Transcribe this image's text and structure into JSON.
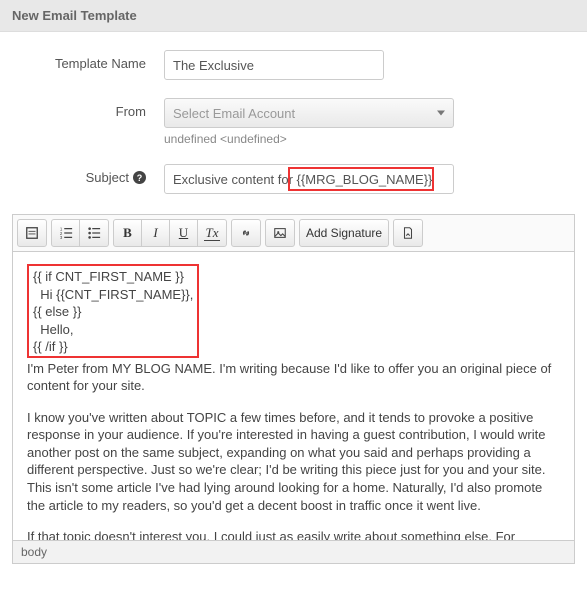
{
  "header": {
    "title": "New Email Template"
  },
  "form": {
    "templateName": {
      "label": "Template Name",
      "value": "The Exclusive"
    },
    "from": {
      "label": "From",
      "placeholder": "Select Email Account",
      "helper": "undefined <undefined>"
    },
    "subject": {
      "label": "Subject",
      "value": "Exclusive content for {{MRG_BLOG_NAME}}"
    }
  },
  "toolbar": {
    "bold": "B",
    "italic": "I",
    "underline": "U",
    "removeFormat": "Tx",
    "addSignature": "Add Signature"
  },
  "editor": {
    "cond_l1": "{{ if CNT_FIRST_NAME }}",
    "cond_l2": "  Hi {{CNT_FIRST_NAME}},",
    "cond_l3": "{{ else }}",
    "cond_l4": "  Hello,",
    "cond_l5": "{{ /if }}",
    "p1": "I'm Peter from MY BLOG NAME. I'm writing because I'd like to offer you an original piece of content for your site.",
    "p2": "I know you've written about TOPIC a few times before, and it tends to provoke a positive response in your audience. If you're interested in having a guest contribution, I would write another post on the same subject, expanding on what you said and perhaps providing a different perspective. Just so we're clear; I'd be writing this piece just for you and your site. This isn't some article I've had lying around looking for a home. Naturally, I'd also promote the article to my readers, so you'd get a decent boost in traffic once it went live.",
    "p3": "If that topic doesn't interest you, I could just as easily write about something else. For example:"
  },
  "statusBar": {
    "path": "body"
  }
}
